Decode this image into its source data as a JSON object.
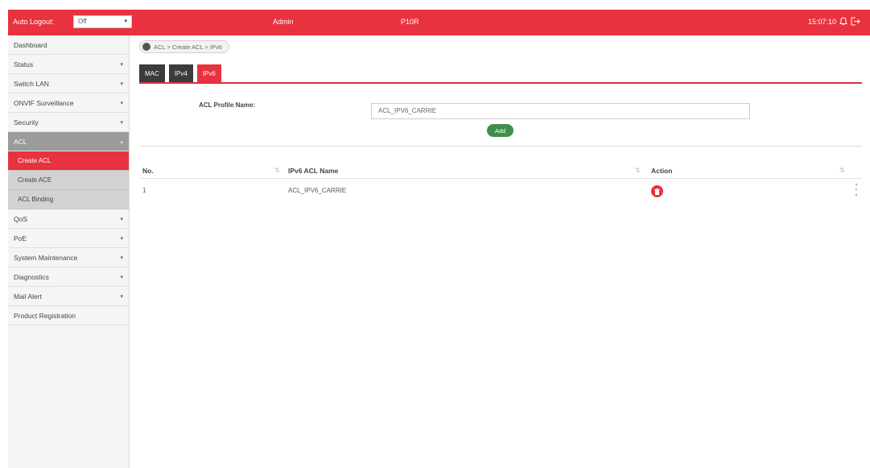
{
  "topbar": {
    "auto_logout_label": "Auto Logout:",
    "auto_logout_value": "Off",
    "user": "Admin",
    "model": "P10R",
    "clock": "15:07:10"
  },
  "sidebar": {
    "items": [
      {
        "label": "Dashboard"
      },
      {
        "label": "Status",
        "caret": "▾"
      },
      {
        "label": "Switch LAN",
        "caret": "▾"
      },
      {
        "label": "ONVIF Surveillance",
        "caret": "▾"
      },
      {
        "label": "Security",
        "caret": "▾"
      },
      {
        "label": "ACL",
        "caret": "▴"
      },
      {
        "label": "QoS",
        "caret": "▾"
      },
      {
        "label": "PoE",
        "caret": "▾"
      },
      {
        "label": "System Maintenance",
        "caret": "▾"
      },
      {
        "label": "Diagnostics",
        "caret": "▾"
      },
      {
        "label": "Mail Alert",
        "caret": "▾"
      },
      {
        "label": "Product Registration"
      }
    ],
    "acl_sub": [
      "Create ACL",
      "Create ACE",
      "ACL Binding"
    ]
  },
  "breadcrumb": "ACL > Create ACL > IPv6",
  "tabs": [
    "MAC",
    "IPv4",
    "IPv6"
  ],
  "form": {
    "profile_label": "ACL Profile Name:",
    "profile_value": "ACL_IPV6_CARRIE",
    "add_label": "Add"
  },
  "table": {
    "headers": [
      "No.",
      "IPv6 ACL Name",
      "Action"
    ],
    "sort_glyph": "⇅",
    "rows": [
      {
        "no": "1",
        "name": "ACL_IPV6_CARRIE"
      }
    ]
  },
  "colors": {
    "brand_red": "#e8323f",
    "tab_dark": "#3b3b3b",
    "add_green": "#3f8f4a"
  }
}
